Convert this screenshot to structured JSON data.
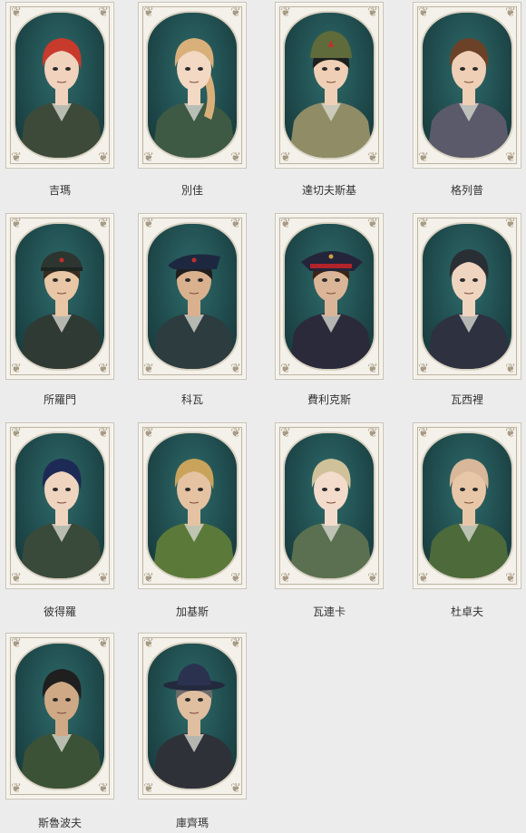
{
  "characters": [
    {
      "name": "吉瑪",
      "hair": "#c83a2c",
      "skin": "#f1d2bd",
      "coat": "#3d4a3a",
      "hat": "none",
      "hair_long": false
    },
    {
      "name": "別佳",
      "hair": "#d9b07a",
      "skin": "#f3d8c4",
      "coat": "#3e5a45",
      "hat": "none",
      "hair_long": true
    },
    {
      "name": "達切夫斯基",
      "hair": "#1f1f1f",
      "skin": "#efd0b6",
      "coat": "#8f8c66",
      "hat": "budenovka",
      "hair_long": false
    },
    {
      "name": "格列普",
      "hair": "#6b4228",
      "skin": "#efcfb5",
      "coat": "#5b5a6a",
      "hat": "none",
      "hair_long": false
    },
    {
      "name": "所羅門",
      "hair": "#3a2a1e",
      "skin": "#e8c6a6",
      "coat": "#2f3a35",
      "hat": "cap",
      "hair_long": false
    },
    {
      "name": "科瓦",
      "hair": "#1f1f1f",
      "skin": "#d9b18f",
      "coat": "#2c3c3f",
      "hat": "peaked",
      "hair_long": false
    },
    {
      "name": "費利克斯",
      "hair": "#3a2418",
      "skin": "#dbb597",
      "coat": "#2b2a3a",
      "hat": "officer",
      "hair_long": false
    },
    {
      "name": "瓦西裡",
      "hair": "#2a2f35",
      "skin": "#efd4c0",
      "coat": "#2d3140",
      "hat": "none",
      "hair_long": false
    },
    {
      "name": "彼得羅",
      "hair": "#1d2a55",
      "skin": "#efd4c0",
      "coat": "#3a4a3a",
      "hat": "none",
      "hair_long": false
    },
    {
      "name": "加基斯",
      "hair": "#c9a35c",
      "skin": "#e4c2a2",
      "coat": "#5b7a3a",
      "hat": "none",
      "hair_long": false
    },
    {
      "name": "瓦連卡",
      "hair": "#cfc29a",
      "skin": "#f3dccb",
      "coat": "#5a7050",
      "hat": "none",
      "hair_long": false
    },
    {
      "name": "杜卓夫",
      "hair": "#d8b79a",
      "skin": "#e8c7a8",
      "coat": "#4c6a3a",
      "hat": "none",
      "hair_long": false
    },
    {
      "name": "斯魯波夫",
      "hair": "#1f1f1f",
      "skin": "#cfa985",
      "coat": "#3c5236",
      "hat": "none",
      "hair_long": false
    },
    {
      "name": "庫齊瑪",
      "hair": "#6b6b6b",
      "skin": "#e0bea0",
      "coat": "#2f3138",
      "hat": "fedora",
      "hair_long": false
    }
  ]
}
